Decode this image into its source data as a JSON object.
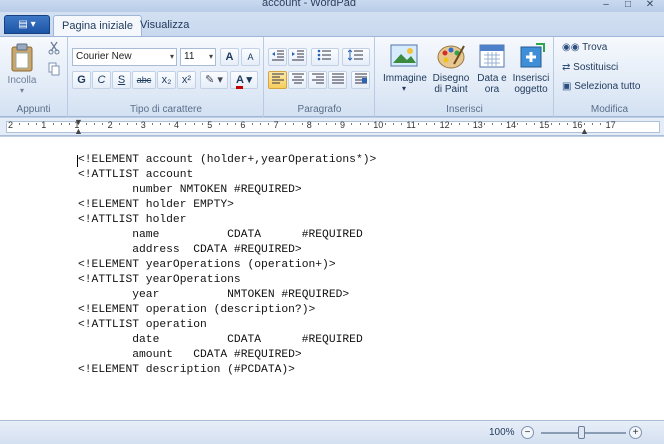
{
  "window": {
    "title": "account - WordPad",
    "minimize": "–",
    "maximize": "□",
    "close": "✕"
  },
  "tabs": {
    "app_menu": "▤ ▾",
    "home": "Pagina iniziale",
    "view": "Visualizza"
  },
  "clipboard": {
    "paste": "Incolla",
    "group": "Appunti"
  },
  "font": {
    "family": "Courier New",
    "size": "11",
    "grow": "A",
    "shrink": "A",
    "bold": "G",
    "italic": "C",
    "underline": "S",
    "strike": "abc",
    "subscript": "x₂",
    "superscript": "x²",
    "highlight": "✎",
    "color": "A",
    "group": "Tipo di carattere"
  },
  "paragraph": {
    "group": "Paragrafo"
  },
  "insert": {
    "image": "Immagine",
    "paint": "Disegno di Paint",
    "datetime": "Data e ora",
    "object": "Inserisci oggetto",
    "group": "Inserisci"
  },
  "editing": {
    "find": "Trova",
    "replace": "Sostituisci",
    "select_all": "Seleziona tutto",
    "group": "Modifica"
  },
  "ruler": {
    "labels": [
      "2",
      "1",
      "1",
      "2",
      "3",
      "4",
      "5",
      "6",
      "7",
      "8",
      "9",
      "10",
      "11",
      "12",
      "13",
      "14",
      "15",
      "16",
      "17"
    ]
  },
  "document": {
    "lines": [
      "<!ELEMENT account (holder+,yearOperations*)>",
      "<!ATTLIST account",
      "        number NMTOKEN #REQUIRED>",
      "<!ELEMENT holder EMPTY>",
      "<!ATTLIST holder",
      "        name          CDATA      #REQUIRED",
      "        address  CDATA #REQUIRED>",
      "<!ELEMENT yearOperations (operation+)>",
      "<!ATTLIST yearOperations",
      "        year          NMTOKEN #REQUIRED>",
      "<!ELEMENT operation (description?)>",
      "<!ATTLIST operation",
      "        date          CDATA      #REQUIRED",
      "        amount   CDATA #REQUIRED>",
      "<!ELEMENT description (#PCDATA)>"
    ]
  },
  "status": {
    "zoom": "100%",
    "zoom_out": "−",
    "zoom_in": "+",
    "zoom_level": 0.43
  }
}
